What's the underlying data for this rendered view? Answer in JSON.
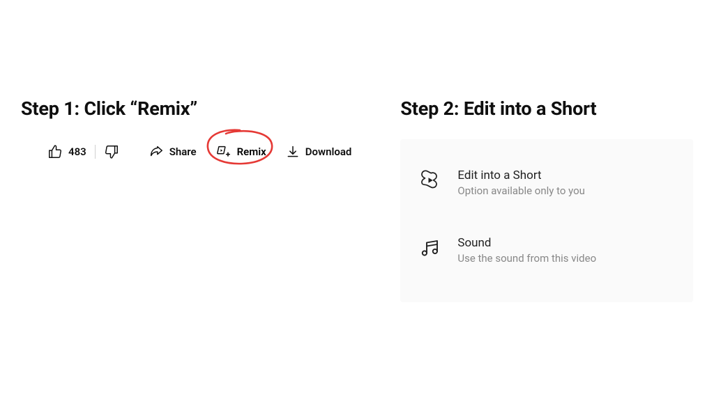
{
  "step1": {
    "heading": "Step 1: Click “Remix”",
    "like_count": "483",
    "share_label": "Share",
    "remix_label": "Remix",
    "download_label": "Download"
  },
  "step2": {
    "heading": "Step 2: Edit into a Short",
    "items": [
      {
        "title": "Edit into a Short",
        "subtitle": "Option available only to you"
      },
      {
        "title": "Sound",
        "subtitle": "Use the sound from this video"
      }
    ]
  },
  "colors": {
    "annotation": "#e53935"
  }
}
